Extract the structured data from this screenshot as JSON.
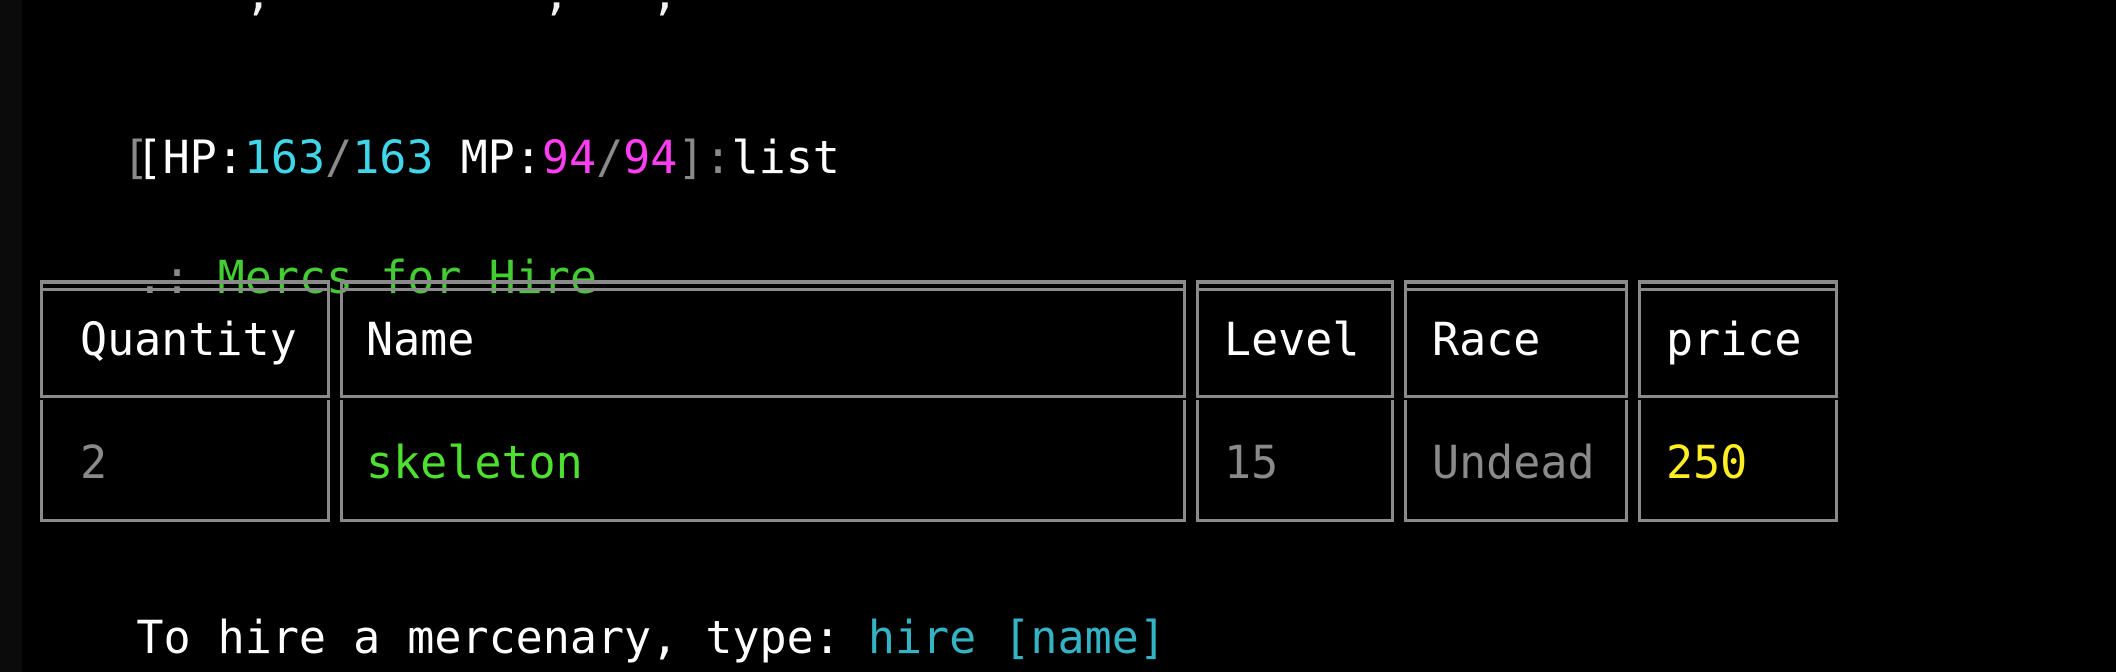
{
  "terminal": {
    "previous_line_fragment": "        ,          ,   ,",
    "prompt": {
      "open": "[",
      "open2": "[",
      "hp_label": "HP:",
      "hp_current": "163",
      "hp_sep": "/",
      "hp_max": "163",
      "mp_label": " MP:",
      "mp_current": "94",
      "mp_sep": "/",
      "mp_max": "94",
      "close": "]",
      "colon": ":",
      "command": "list"
    },
    "section": {
      "prefix": ".: ",
      "title": "Mercs for Hire"
    },
    "table": {
      "headers": [
        "Quantity",
        "Name",
        "Level",
        "Race",
        "price"
      ],
      "rows": [
        {
          "quantity": "2",
          "name": "skeleton",
          "level": "15",
          "race": "Undead",
          "price": "250"
        }
      ]
    },
    "footer": {
      "text": "To hire a mercenary, type: ",
      "command": "hire [name]"
    },
    "colors": {
      "background": "#000000",
      "hp": "#3ed6e8",
      "mp": "#ff3df2",
      "title": "#44cc33",
      "name": "#4ee030",
      "price": "#ffee22",
      "muted": "#8a8a8a",
      "command_hint": "#34b3c4"
    }
  }
}
